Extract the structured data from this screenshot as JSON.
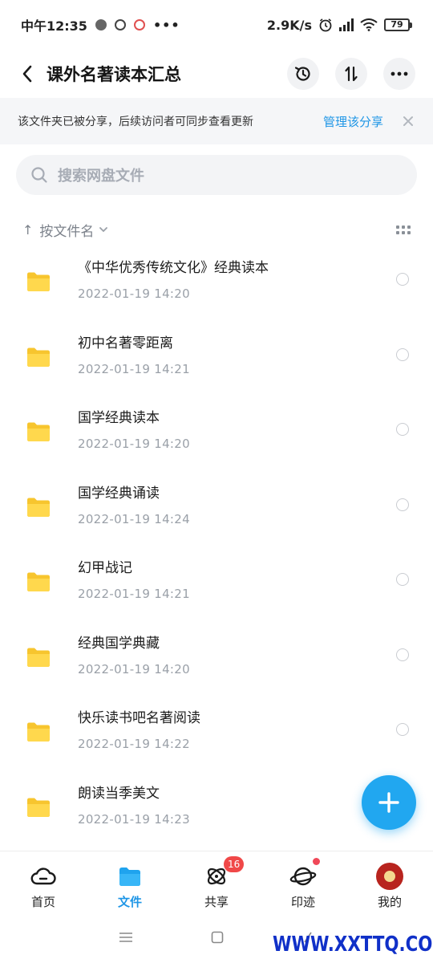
{
  "status_bar": {
    "time": "中午12:35",
    "dots": "•••",
    "speed": "2.9K/s",
    "battery": "79"
  },
  "header": {
    "title": "课外名著读本汇总"
  },
  "share_banner": {
    "text": "该文件夹已被分享，后续访问者可同步查看更新",
    "manage_label": "管理该分享"
  },
  "search": {
    "placeholder": "搜索网盘文件"
  },
  "sort": {
    "label": "按文件名"
  },
  "files": [
    {
      "name": "《中华优秀传统文化》经典读本",
      "date": "2022-01-19  14:20"
    },
    {
      "name": "初中名著零距离",
      "date": "2022-01-19  14:21"
    },
    {
      "name": "国学经典读本",
      "date": "2022-01-19  14:20"
    },
    {
      "name": "国学经典诵读",
      "date": "2022-01-19  14:24"
    },
    {
      "name": "幻甲战记",
      "date": "2022-01-19  14:21"
    },
    {
      "name": "经典国学典藏",
      "date": "2022-01-19  14:20"
    },
    {
      "name": "快乐读书吧名著阅读",
      "date": "2022-01-19  14:22"
    },
    {
      "name": "朗读当季美文",
      "date": "2022-01-19  14:23"
    }
  ],
  "bottom_nav": [
    {
      "label": "首页",
      "icon": "cloud-icon"
    },
    {
      "label": "文件",
      "icon": "folder-icon",
      "active": true
    },
    {
      "label": "共享",
      "icon": "atom-icon",
      "badge": "16"
    },
    {
      "label": "印迹",
      "icon": "planet-icon",
      "dot": true
    },
    {
      "label": "我的",
      "icon": "avatar"
    }
  ],
  "watermark": "WWW.XXTTQ.COM",
  "colors": {
    "accent": "#1f96e6",
    "fab": "#21a7f0",
    "folder": "#ffd64a",
    "badge": "#f04848"
  }
}
